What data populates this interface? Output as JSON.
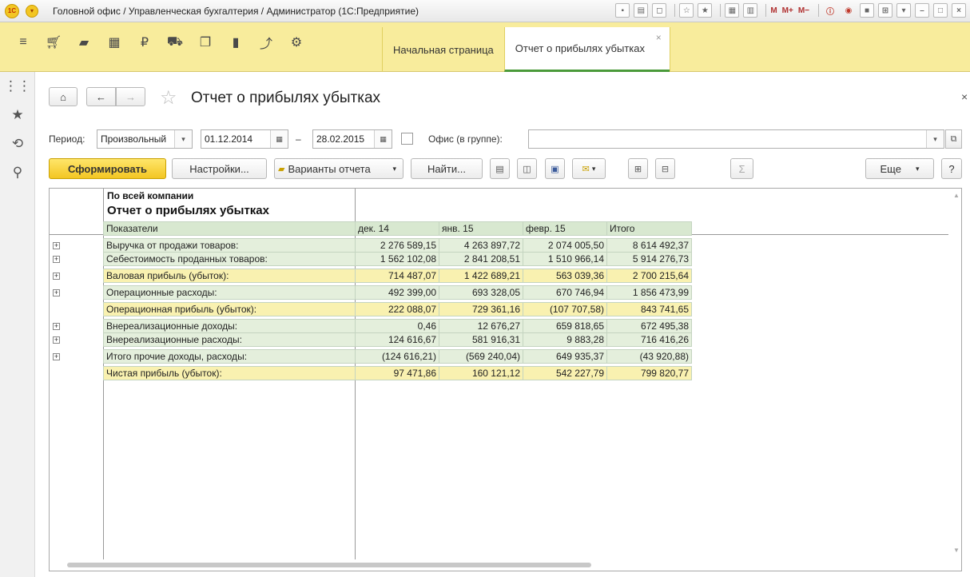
{
  "titlebar": {
    "text": "Головной офис / Управленческая бухгалтерия / Администратор  (1С:Предприятие)",
    "logo": "1С",
    "tools": [
      "M",
      "M+",
      "M−"
    ]
  },
  "tabs": [
    {
      "label": "Начальная страница"
    },
    {
      "label": "Отчет о прибылях убытках"
    }
  ],
  "header": {
    "title": "Отчет о прибылях убытках"
  },
  "filters": {
    "period_label": "Период:",
    "period_value": "Произвольный",
    "date_from": "01.12.2014",
    "dash": "–",
    "date_to": "28.02.2015",
    "office_label": "Офис (в группе):",
    "office_value": ""
  },
  "actions": {
    "generate": "Сформировать",
    "settings": "Настройки...",
    "variants": "Варианты отчета",
    "find": "Найти...",
    "more": "Еще",
    "help": "?",
    "sigma": "Σ"
  },
  "report": {
    "company": "По всей компании",
    "title": "Отчет о прибылях убытках",
    "columns": [
      "Показатели",
      "дек. 14",
      "янв. 15",
      "февр. 15",
      "Итого"
    ],
    "rows": [
      {
        "name": "Выручка от продажи товаров:",
        "v": [
          "2 276 589,15",
          "4 263 897,72",
          "2 074 005,50",
          "8 614 492,37"
        ]
      },
      {
        "name": "Себестоимость проданных товаров:",
        "v": [
          "1 562 102,08",
          "2 841 208,51",
          "1 510 966,14",
          "5 914 276,73"
        ]
      },
      {
        "name": "Валовая прибыль (убыток):",
        "v": [
          "714 487,07",
          "1 422 689,21",
          "563 039,36",
          "2 700 215,64"
        ]
      },
      {
        "name": "Операционные расходы:",
        "v": [
          "492 399,00",
          "693 328,05",
          "670 746,94",
          "1 856 473,99"
        ]
      },
      {
        "name": "Операционная прибыль (убыток):",
        "v": [
          "222 088,07",
          "729 361,16",
          "(107 707,58)",
          "843 741,65"
        ]
      },
      {
        "name": "Внереализационные доходы:",
        "v": [
          "0,46",
          "12 676,27",
          "659 818,65",
          "672 495,38"
        ]
      },
      {
        "name": "Внереализационные расходы:",
        "v": [
          "124 616,67",
          "581 916,31",
          "9 883,28",
          "716 416,26"
        ]
      },
      {
        "name": "Итого прочие доходы, расходы:",
        "v": [
          "(124 616,21)",
          "(569 240,04)",
          "649 935,37",
          "(43 920,88)"
        ]
      },
      {
        "name": "Чистая прибыль (убыток):",
        "v": [
          "97 471,86",
          "160 121,12",
          "542 227,79",
          "799 820,77"
        ]
      }
    ]
  }
}
